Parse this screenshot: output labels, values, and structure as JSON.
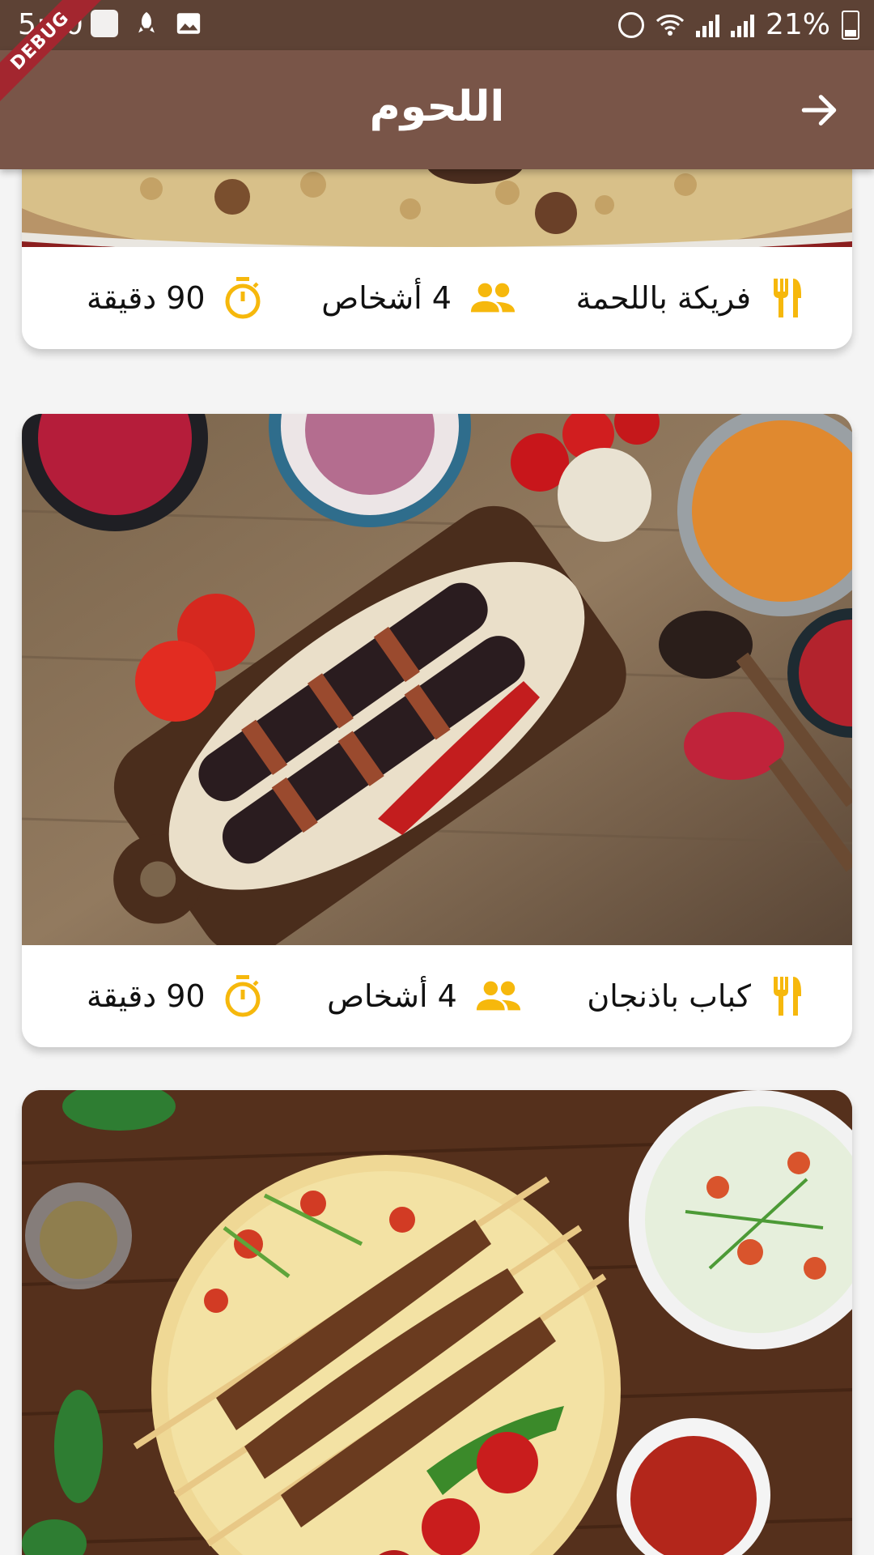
{
  "status_bar": {
    "time": "5:50",
    "battery": "21%"
  },
  "debug_label": "DEBUG",
  "app_bar": {
    "title": "اللحوم",
    "back_icon": "arrow-forward-icon"
  },
  "recipes": [
    {
      "name": "فريكة باللحمة",
      "servings": "4 أشخاص",
      "time": "90 دقيقة"
    },
    {
      "name": "كباب باذنجان",
      "servings": "4 أشخاص",
      "time": "90 دقيقة"
    }
  ],
  "colors": {
    "status_bar": "#5d4235",
    "app_bar": "#795548",
    "accent": "#f6b80c",
    "debug_ribbon": "#a3262f"
  },
  "icons": {
    "name": "utensils-icon",
    "servings": "people-icon",
    "time": "timer-icon"
  }
}
